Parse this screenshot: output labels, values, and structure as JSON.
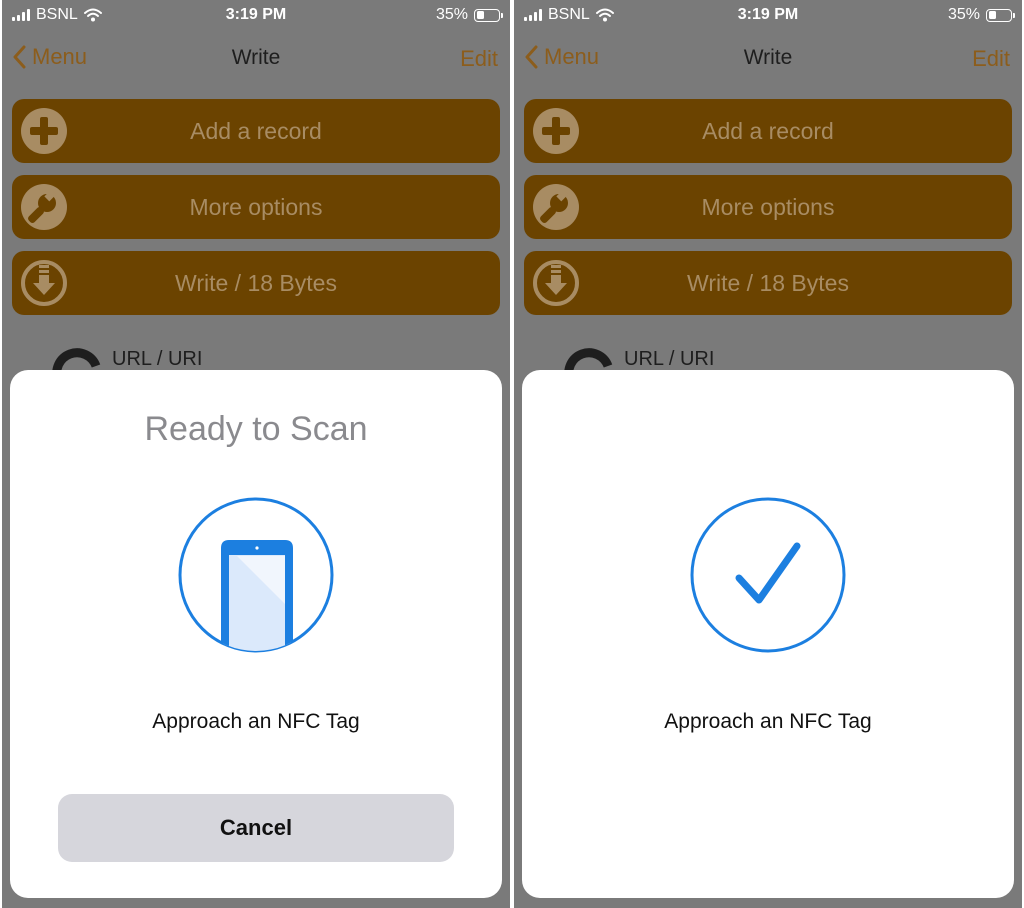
{
  "colors": {
    "accent": "#8c5d1c",
    "button_bg": "#6b4300",
    "button_text": "#a88c63",
    "scan_blue": "#1c7fe0",
    "overlay": "#7a7a7a",
    "cancel_bg": "#d6d6dc"
  },
  "screens": [
    {
      "status_bar": {
        "carrier": "BSNL",
        "time": "3:19 PM",
        "battery": "35%",
        "battery_level": 0.35
      },
      "nav": {
        "back_label": "Menu",
        "title": "Write",
        "edit_label": "Edit"
      },
      "actions": {
        "add_record": "Add a record",
        "more_options": "More options",
        "write": "Write / 18 Bytes"
      },
      "record": {
        "label": "URL / URI"
      },
      "sheet": {
        "title": "Ready to Scan",
        "icon": "phone-scan-icon",
        "message": "Approach an NFC Tag",
        "cancel_label": "Cancel"
      }
    },
    {
      "status_bar": {
        "carrier": "BSNL",
        "time": "3:19 PM",
        "battery": "35%",
        "battery_level": 0.35
      },
      "nav": {
        "back_label": "Menu",
        "title": "Write",
        "edit_label": "Edit"
      },
      "actions": {
        "add_record": "Add a record",
        "more_options": "More options",
        "write": "Write / 18 Bytes"
      },
      "record": {
        "label": "URL / URI"
      },
      "sheet": {
        "icon": "checkmark-icon",
        "message": "Approach an NFC Tag"
      }
    }
  ]
}
